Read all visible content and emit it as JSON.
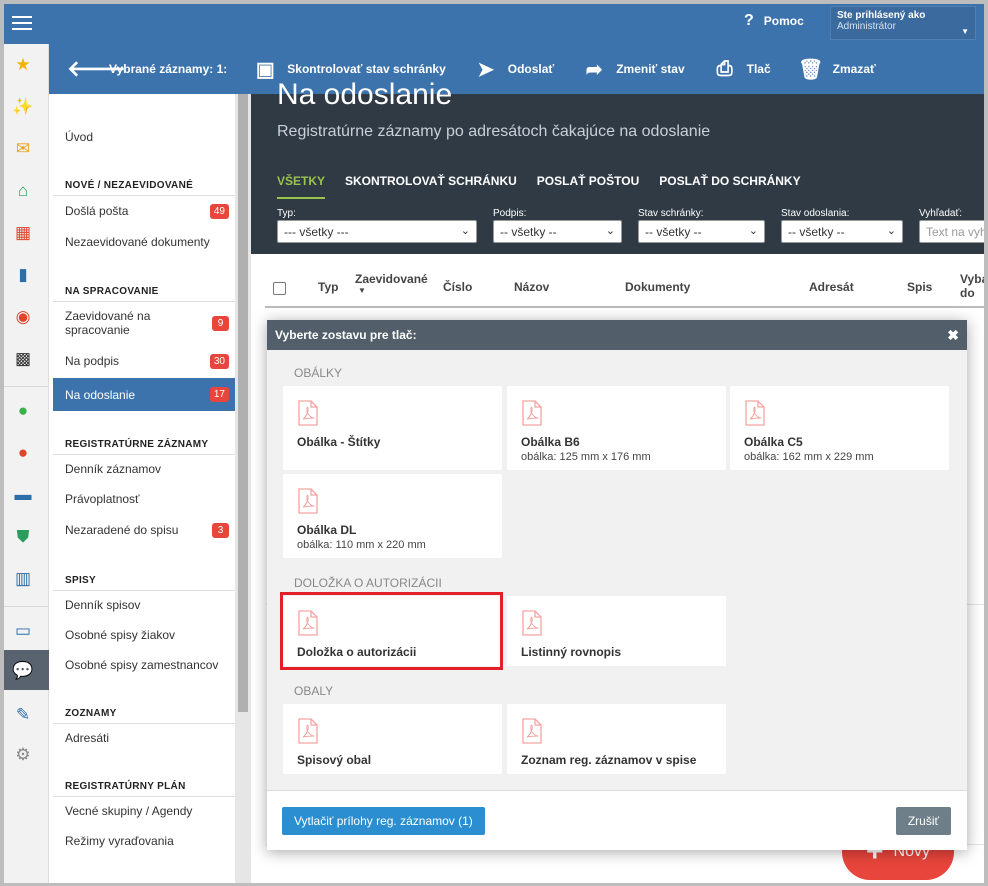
{
  "topbar": {
    "help_label": "Pomoc",
    "user_prefix": "Ste prihlásený ako",
    "user_name": "Administrátor"
  },
  "toolbar": {
    "selected_label": "Vybrané záznamy: 1:",
    "check_mailbox": "Skontrolovať stav schránky",
    "send": "Odoslať",
    "change_state": "Zmeniť stav",
    "print": "Tlač",
    "delete": "Zmazať"
  },
  "nav": {
    "home": "Úvod",
    "sec_new": "NOVÉ / NEZAEVIDOVANÉ",
    "incoming": "Došlá pošta",
    "incoming_count": "49",
    "unregistered": "Nezaevidované dokumenty",
    "sec_processing": "NA SPRACOVANIE",
    "registered_processing_1": "Zaevidované na",
    "registered_processing_2": "spracovanie",
    "registered_processing_count": "9",
    "to_sign": "Na podpis",
    "to_sign_count": "30",
    "to_send": "Na odoslanie",
    "to_send_count": "17",
    "sec_registry": "REGISTRATÚRNE ZÁZNAMY",
    "diary": "Denník záznamov",
    "validity": "Právoplatnosť",
    "unassigned": "Nezaradené do spisu",
    "unassigned_count": "3",
    "sec_files": "SPISY",
    "file_diary": "Denník spisov",
    "student_files": "Osobné spisy žiakov",
    "employee_files": "Osobné spisy zamestnancov",
    "sec_lists": "ZOZNAMY",
    "addressees": "Adresáti",
    "sec_plan": "REGISTRATÚRNY PLÁN",
    "groups": "Vecné skupiny / Agendy",
    "disposal": "Režimy vyraďovania"
  },
  "page": {
    "title": "Na odoslanie",
    "subtitle": "Registratúrne záznamy po adresátoch čakajúce na odoslanie",
    "tabs": [
      "VŠETKY",
      "SKONTROLOVAŤ SCHRÁNKU",
      "POSLAŤ POŠTOU",
      "POSLAŤ DO SCHRÁNKY"
    ],
    "filters": [
      {
        "label": "Typ:",
        "value": "--- všetky ---"
      },
      {
        "label": "Podpis:",
        "value": "-- všetky --"
      },
      {
        "label": "Stav schránky:",
        "value": "-- všetky --"
      },
      {
        "label": "Stav odoslania:",
        "value": "-- všetky --"
      },
      {
        "label": "Vyhľadať:",
        "placeholder": "Text na vyh"
      }
    ],
    "columns": [
      "Typ",
      "Zaevidované",
      "Číslo",
      "Názov",
      "Dokumenty",
      "Adresát",
      "Spis",
      "Vyba",
      "do"
    ],
    "fab_label": "Nový"
  },
  "modal": {
    "title": "Vyberte zostavu pre tlač:",
    "sections": [
      {
        "title": "OBÁLKY",
        "items": [
          {
            "name": "Obálka - Štítky",
            "desc": ""
          },
          {
            "name": "Obálka B6",
            "desc": "obálka: 125 mm x 176 mm"
          },
          {
            "name": "Obálka C5",
            "desc": "obálka: 162 mm x 229 mm"
          },
          {
            "name": "Obálka DL",
            "desc": "obálka: 110 mm x 220 mm"
          }
        ]
      },
      {
        "title": "DOLOŽKA O AUTORIZÁCII",
        "items": [
          {
            "name": "Doložka o autorizácii",
            "desc": ""
          },
          {
            "name": "Listinný rovnopis",
            "desc": ""
          }
        ]
      },
      {
        "title": "OBALY",
        "items": [
          {
            "name": "Spisový obal",
            "desc": ""
          },
          {
            "name": "Zoznam reg. záznamov v spise",
            "desc": ""
          }
        ]
      }
    ],
    "print_attachments": "Vytlačiť prílohy reg. záznamov (1)",
    "cancel": "Zrušiť"
  },
  "colors": {
    "primary": "#3c73ad",
    "dark": "#2f3a45",
    "accent_green": "#9bc44a",
    "badge_red": "#e8453c",
    "highlight": "#e3202a"
  }
}
